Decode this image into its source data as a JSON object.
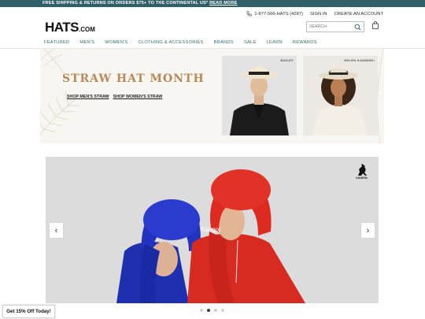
{
  "promo": {
    "text": "FREE SHIPPING & RETURNS ON ORDERS $75+ TO THE CONTINENTAL US*",
    "link": "READ MORE"
  },
  "utility": {
    "phone": "1-877-566-HATS (4287)",
    "signin": "SIGN IN",
    "create_account": "CREATE AN ACCOUNT"
  },
  "logo": {
    "main": "HATS",
    "suffix": ".COM"
  },
  "search": {
    "placeholder": "SEARCH"
  },
  "nav": {
    "items": [
      "FEATURED",
      "MEN'S",
      "WOMEN'S",
      "CLOTHING & ACCESSORIES",
      "BRANDS",
      "SALE",
      "LEARN",
      "REWARDS"
    ]
  },
  "straw_banner": {
    "title": "STRAW HAT MONTH",
    "link_mens": "SHOP MEN'S STRAW",
    "link_womens": "SHOP WOMEN'S STRAW",
    "brand1": "BAILEY",
    "brand2": "HELEN KAMINSKI"
  },
  "hero": {
    "label": "Kangol",
    "brand": "KANGOL"
  },
  "carousel": {
    "slide_count": 4,
    "active_index": 1
  },
  "offer": {
    "text": "Get 15% Off Today!"
  },
  "colors": {
    "promo_bg": "#2f5f67",
    "nav_text": "#2f6f78",
    "straw_title": "#b78a58",
    "hat_blue": "#2436b8",
    "hat_red": "#d9281f"
  }
}
